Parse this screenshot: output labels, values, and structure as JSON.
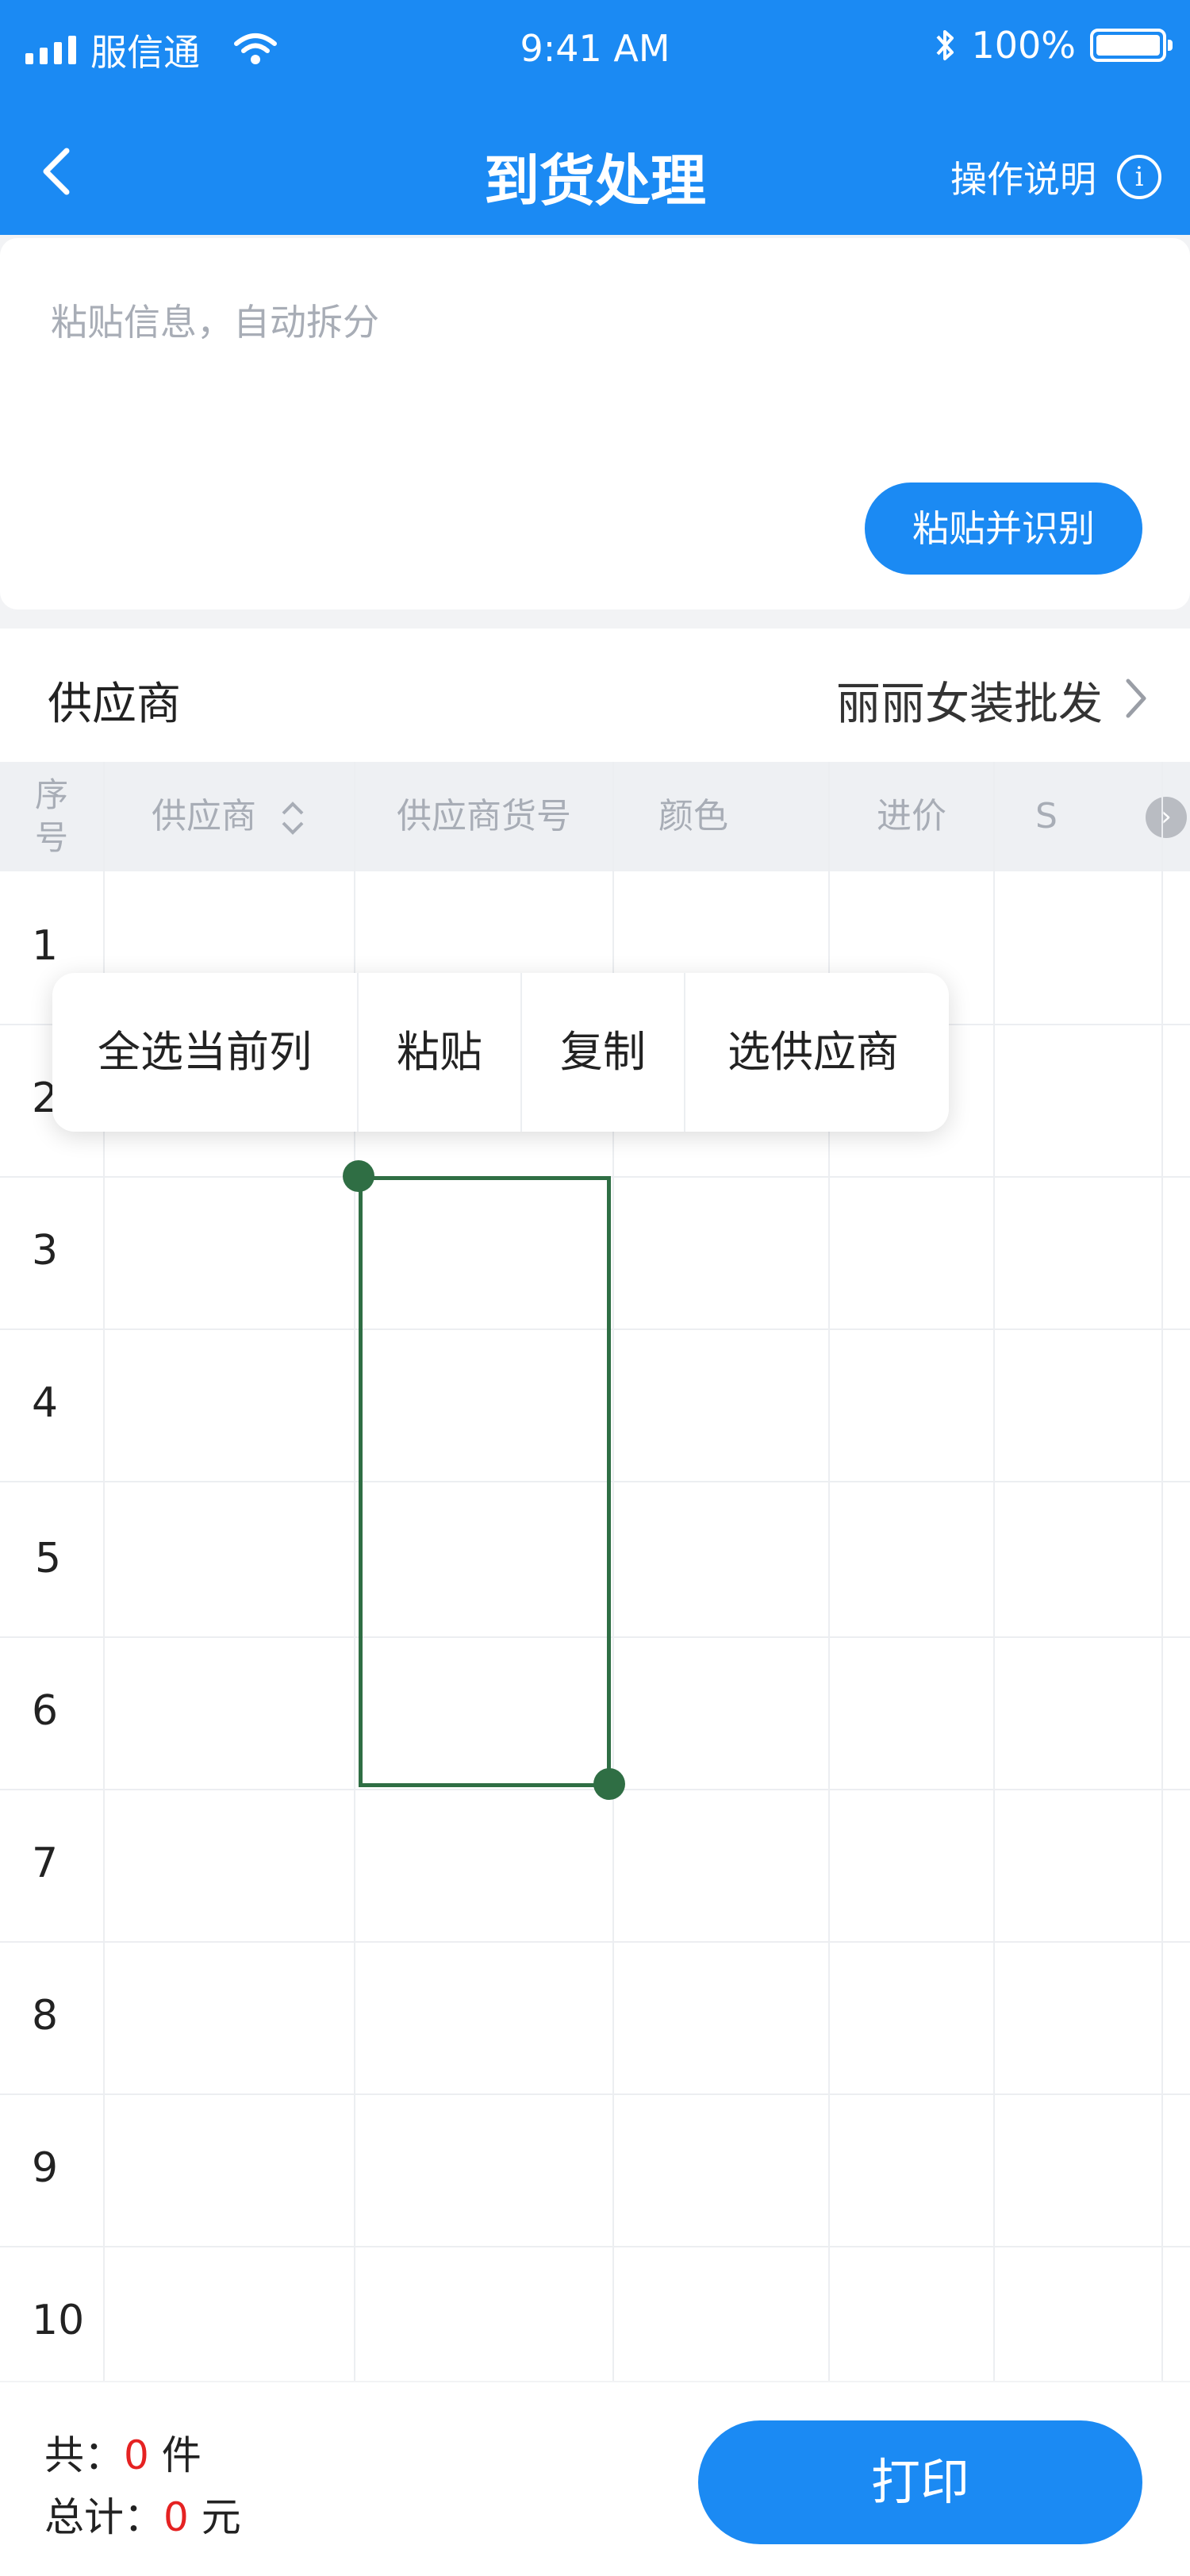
{
  "status_bar": {
    "carrier": "服信通",
    "time": "9:41 AM",
    "battery": "100%"
  },
  "nav": {
    "title": "到货处理",
    "help_label": "操作说明",
    "help_icon": "i"
  },
  "paste": {
    "placeholder": "粘贴信息，自动拆分",
    "button_label": "粘贴并识别"
  },
  "supplier": {
    "label": "供应商",
    "value": "丽丽女装批发"
  },
  "table": {
    "headers": {
      "index": "序号",
      "supplier": "供应商",
      "supplier_code": "供应商货号",
      "color": "颜色",
      "price": "进价",
      "size": "S"
    },
    "rows": [
      "1",
      "2",
      "3",
      "4",
      "5",
      "6",
      "7",
      "8",
      "9",
      "10"
    ]
  },
  "context_menu": {
    "select_column": "全选当前列",
    "paste": "粘贴",
    "copy": "复制",
    "choose_supplier": "选供应商"
  },
  "footer": {
    "count_prefix": "共：",
    "count_value": "0",
    "count_unit": "件",
    "total_prefix": "总计：",
    "total_value": "0",
    "total_unit": "元",
    "print_label": "打印"
  }
}
